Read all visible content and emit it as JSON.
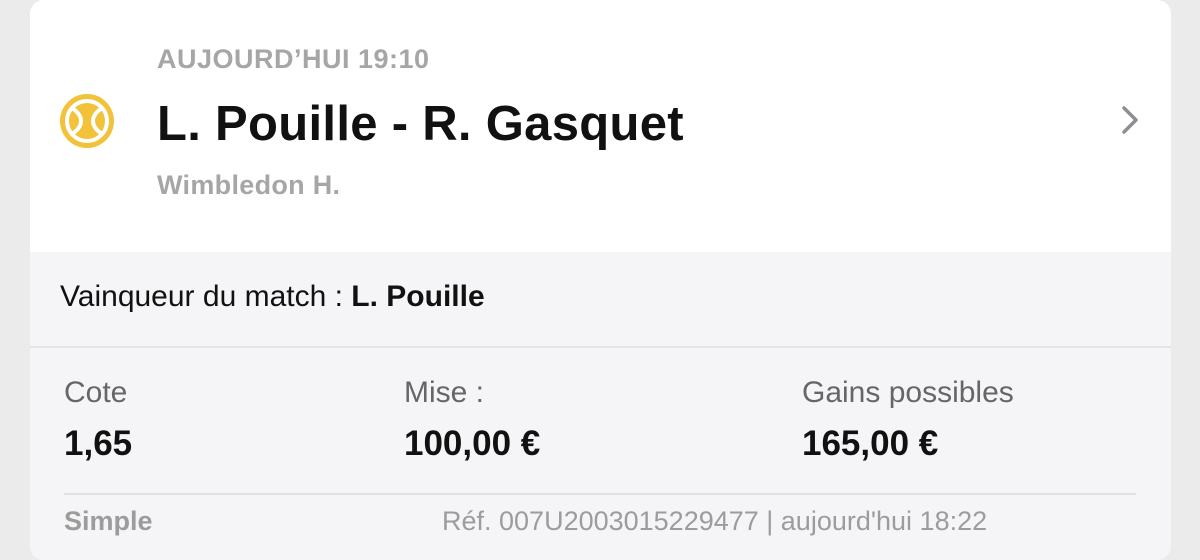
{
  "event": {
    "date": "AUJOURD’HUI 19:10",
    "title": "L. Pouille - R. Gasquet",
    "competition": "Wimbledon H.",
    "sport_icon": "tennis-ball-icon",
    "chevron_icon": "chevron-right-icon"
  },
  "selection": {
    "market": "Vainqueur du match : ",
    "pick": "L. Pouille"
  },
  "bet": {
    "odds_label": "Cote",
    "odds_value": "1,65",
    "stake_label": "Mise :",
    "stake_value": "100,00 €",
    "gains_label": "Gains possibles",
    "gains_value": "165,00 €"
  },
  "footer": {
    "type": "Simple",
    "reference": "Réf. 007U2003015229477 | aujourd'hui 18:22"
  },
  "colors": {
    "accent": "#f2c33a",
    "background": "#ebebeb",
    "muted_text": "#a6a6a6"
  }
}
